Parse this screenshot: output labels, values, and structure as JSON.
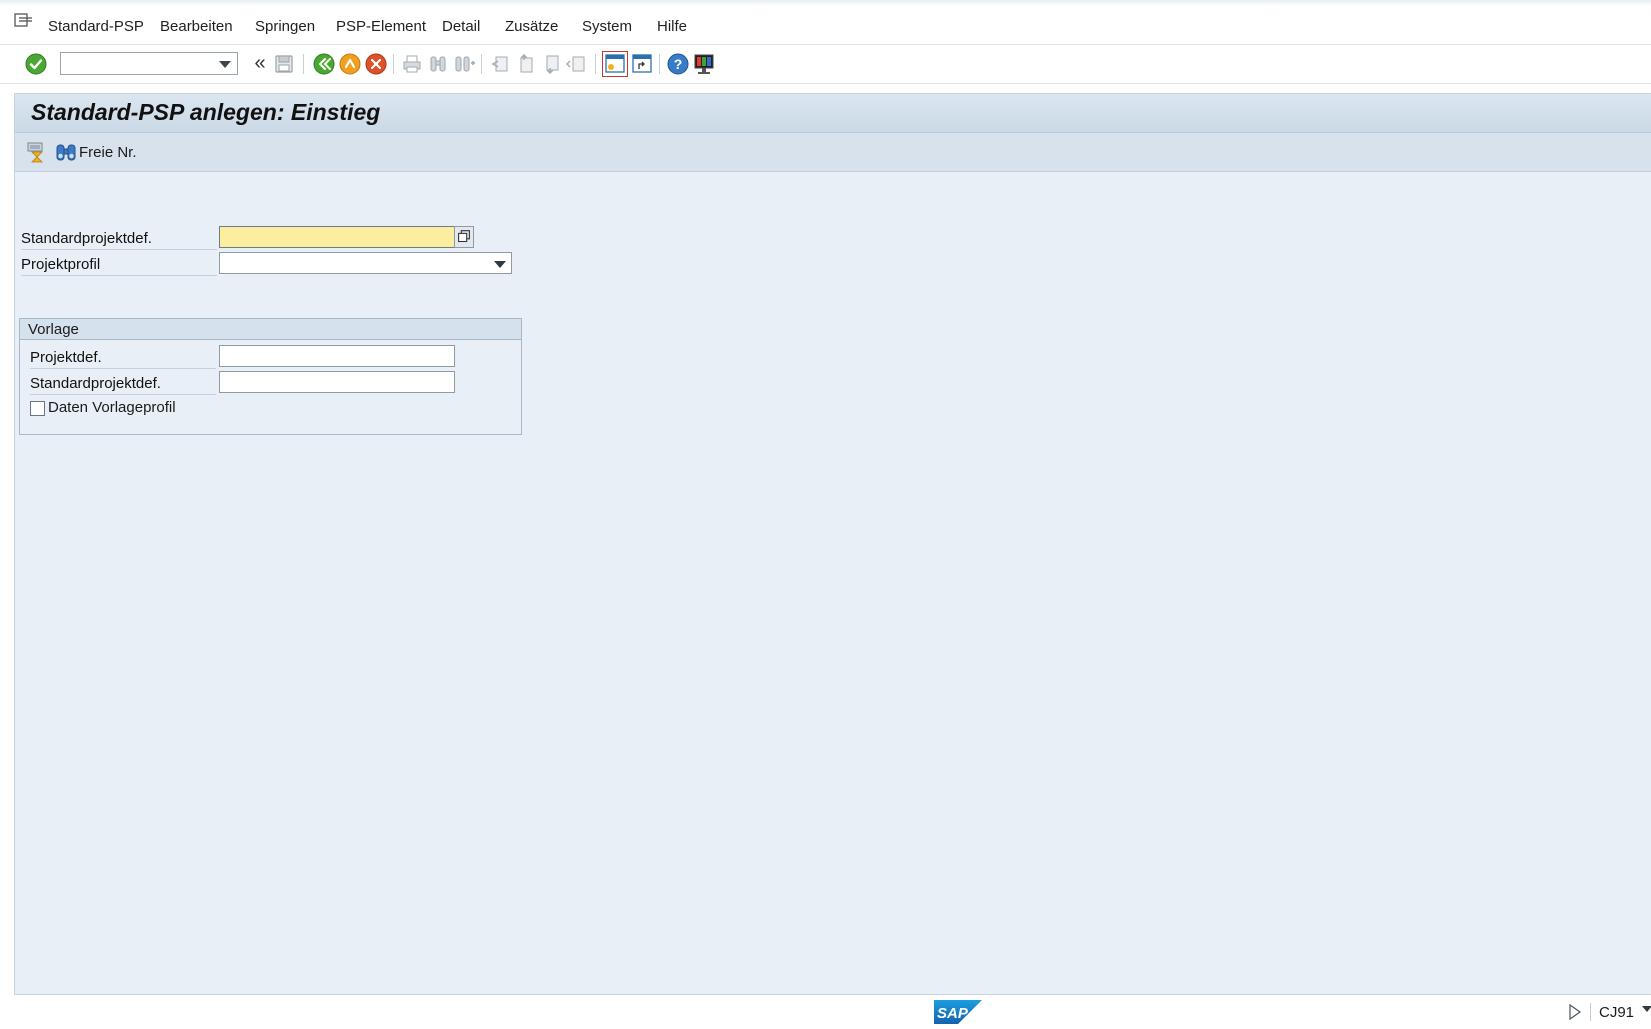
{
  "menubar": {
    "items": [
      {
        "label": "Standard-PSP"
      },
      {
        "label": "Bearbeiten"
      },
      {
        "label": "Springen"
      },
      {
        "label": "PSP-Element"
      },
      {
        "label": "Detail"
      },
      {
        "label": "Zusätze"
      },
      {
        "label": "System"
      },
      {
        "label": "Hilfe"
      }
    ]
  },
  "toolbar": {
    "command_value": "",
    "back_glyph": "«"
  },
  "screen": {
    "title": "Standard-PSP anlegen: Einstieg",
    "app_toolbar": {
      "freie_nr_label": "Freie Nr."
    }
  },
  "form": {
    "standardprojektdef_label": "Standardprojektdef.",
    "standardprojektdef_value": "",
    "projektprofil_label": "Projektprofil",
    "projektprofil_value": ""
  },
  "vorlage": {
    "title": "Vorlage",
    "projektdef_label": "Projektdef.",
    "projektdef_value": "",
    "standardprojektdef_label": "Standardprojektdef.",
    "standardprojektdef_value": "",
    "daten_vorlageprofil_label": "Daten Vorlageprofil",
    "daten_vorlageprofil_checked": false
  },
  "statusbar": {
    "transaction": "CJ91",
    "logo_text": "SAP"
  },
  "colors": {
    "focus_field": "#fbef9f",
    "panel_bg": "#e8eff6",
    "accept_green": "#4aa832",
    "cancel_red": "#e0502a",
    "exit_orange": "#f0a020"
  }
}
